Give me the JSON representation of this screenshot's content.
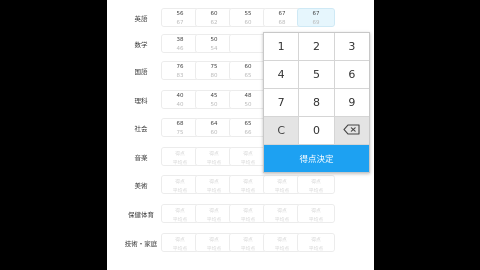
{
  "subjects": [
    "英語",
    "数学",
    "国語",
    "理科",
    "社会",
    "音楽",
    "美術",
    "保健体育",
    "技術・家庭"
  ],
  "grid": [
    [
      {
        "top": "56",
        "bot": "67"
      },
      {
        "top": "60",
        "bot": "62"
      },
      {
        "top": "55",
        "bot": "60"
      },
      {
        "top": "67",
        "bot": "68"
      },
      {
        "top": "67",
        "bot": "69",
        "sel": true
      }
    ],
    [
      {
        "top": "38",
        "bot": "46"
      },
      {
        "top": "50",
        "bot": "54"
      },
      {
        "top": "",
        "bot": ""
      },
      {
        "top": "",
        "bot": ""
      },
      {
        "top": "",
        "bot": ""
      }
    ],
    [
      {
        "top": "76",
        "bot": "83"
      },
      {
        "top": "75",
        "bot": "80"
      },
      {
        "top": "60",
        "bot": "65"
      },
      {
        "top": "",
        "bot": ""
      },
      {
        "top": "",
        "bot": ""
      }
    ],
    [
      {
        "top": "40",
        "bot": "40"
      },
      {
        "top": "45",
        "bot": "50"
      },
      {
        "top": "48",
        "bot": "50"
      },
      {
        "top": "",
        "bot": ""
      },
      {
        "top": "",
        "bot": ""
      }
    ],
    [
      {
        "top": "68",
        "bot": "75"
      },
      {
        "top": "64",
        "bot": "60"
      },
      {
        "top": "65",
        "bot": "66"
      },
      {
        "top": "",
        "bot": ""
      },
      {
        "top": "",
        "bot": ""
      }
    ],
    [
      {
        "top": "得点",
        "bot": "平均点",
        "empty": true
      },
      {
        "top": "得点",
        "bot": "平均点",
        "empty": true
      },
      {
        "top": "得点",
        "bot": "平均点",
        "empty": true
      },
      {
        "top": "得点",
        "bot": "平均点",
        "empty": true
      },
      {
        "top": "得点",
        "bot": "平均点",
        "empty": true
      }
    ],
    [
      {
        "top": "得点",
        "bot": "平均点",
        "empty": true
      },
      {
        "top": "得点",
        "bot": "平均点",
        "empty": true
      },
      {
        "top": "得点",
        "bot": "平均点",
        "empty": true
      },
      {
        "top": "得点",
        "bot": "平均点",
        "empty": true
      },
      {
        "top": "得点",
        "bot": "平均点",
        "empty": true
      }
    ],
    [
      {
        "top": "得点",
        "bot": "平均点",
        "empty": true
      },
      {
        "top": "得点",
        "bot": "平均点",
        "empty": true
      },
      {
        "top": "得点",
        "bot": "平均点",
        "empty": true
      },
      {
        "top": "得点",
        "bot": "平均点",
        "empty": true
      },
      {
        "top": "得点",
        "bot": "平均点",
        "empty": true
      }
    ],
    [
      {
        "top": "得点",
        "bot": "平均点",
        "empty": true
      },
      {
        "top": "得点",
        "bot": "平均点",
        "empty": true
      },
      {
        "top": "得点",
        "bot": "平均点",
        "empty": true
      },
      {
        "top": "得点",
        "bot": "平均点",
        "empty": true
      },
      {
        "top": "得点",
        "bot": "平均点",
        "empty": true
      }
    ]
  ],
  "keypad": {
    "rows": [
      [
        "1",
        "2",
        "3"
      ],
      [
        "4",
        "5",
        "6"
      ],
      [
        "7",
        "8",
        "9"
      ],
      [
        "C",
        "0",
        "backspace-icon"
      ]
    ],
    "confirm_label": "得点決定"
  },
  "colors": {
    "accent": "#1da1f2",
    "selected_cell": "#e6f6fd"
  }
}
